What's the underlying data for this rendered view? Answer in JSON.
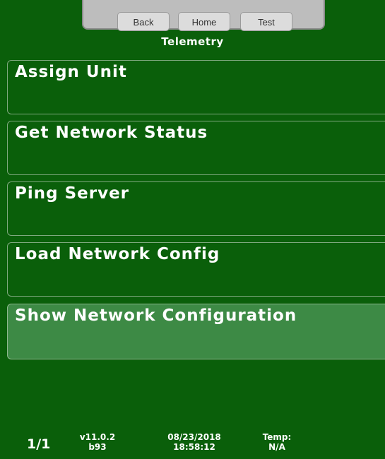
{
  "nav": {
    "back_label": "Back",
    "home_label": "Home",
    "test_label": "Test"
  },
  "screen": {
    "title": "Telemetry"
  },
  "menu": {
    "items": [
      {
        "label": "Assign Unit",
        "selected": false
      },
      {
        "label": "Get Network Status",
        "selected": false
      },
      {
        "label": "Ping Server",
        "selected": false
      },
      {
        "label": "Load Network Config",
        "selected": false
      },
      {
        "label": "Show Network Configuration",
        "selected": true
      }
    ]
  },
  "footer": {
    "page": "1/1",
    "version": "v11.0.2",
    "build": "b93",
    "date": "08/23/2018",
    "time": "18:58:12",
    "temp_label": "Temp:",
    "temp_value": "N/A"
  },
  "colors": {
    "background": "#0a5f0a",
    "selected_item": "#3d8a45",
    "nav_panel": "#bdbdbd",
    "text": "#ffffff"
  }
}
